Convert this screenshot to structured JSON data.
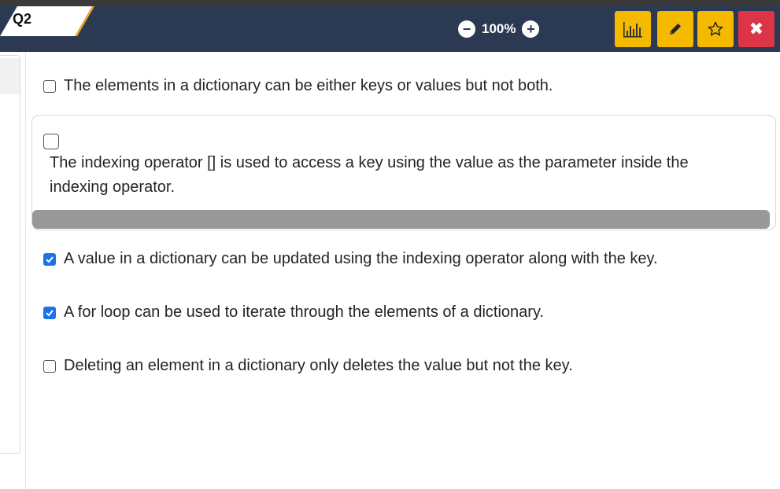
{
  "header": {
    "question_tab": "Q2",
    "zoom": {
      "value": "100%",
      "decrease_icon": "minus-circle-icon",
      "increase_icon": "plus-circle-icon"
    },
    "buttons": [
      {
        "name": "stats-button",
        "icon": "bar-chart-icon",
        "color": "#f5b900"
      },
      {
        "name": "edit-button",
        "icon": "pencil-icon",
        "color": "#f5b900"
      },
      {
        "name": "favorite-button",
        "icon": "star-outline-icon",
        "color": "#f5b900"
      },
      {
        "name": "close-button",
        "icon": "close-icon",
        "color": "#dc3545"
      }
    ]
  },
  "options": [
    {
      "text": "The elements in a dictionary can be either keys or values but not both.",
      "checked": false
    },
    {
      "text": "The indexing operator [] is used to access a key using the value as the parameter inside the indexing operator.",
      "checked": false
    },
    {
      "text": "A value in a dictionary can be updated using the indexing operator along with the key.",
      "checked": true
    },
    {
      "text": "A for loop can be used to iterate through the elements of a dictionary.",
      "checked": true
    },
    {
      "text": "Deleting an element in a dictionary only deletes the value but not the key.",
      "checked": false
    }
  ],
  "colors": {
    "header_bg": "#2b3a52",
    "accent": "#f0a020",
    "checkbox_checked": "#1a73e8"
  }
}
